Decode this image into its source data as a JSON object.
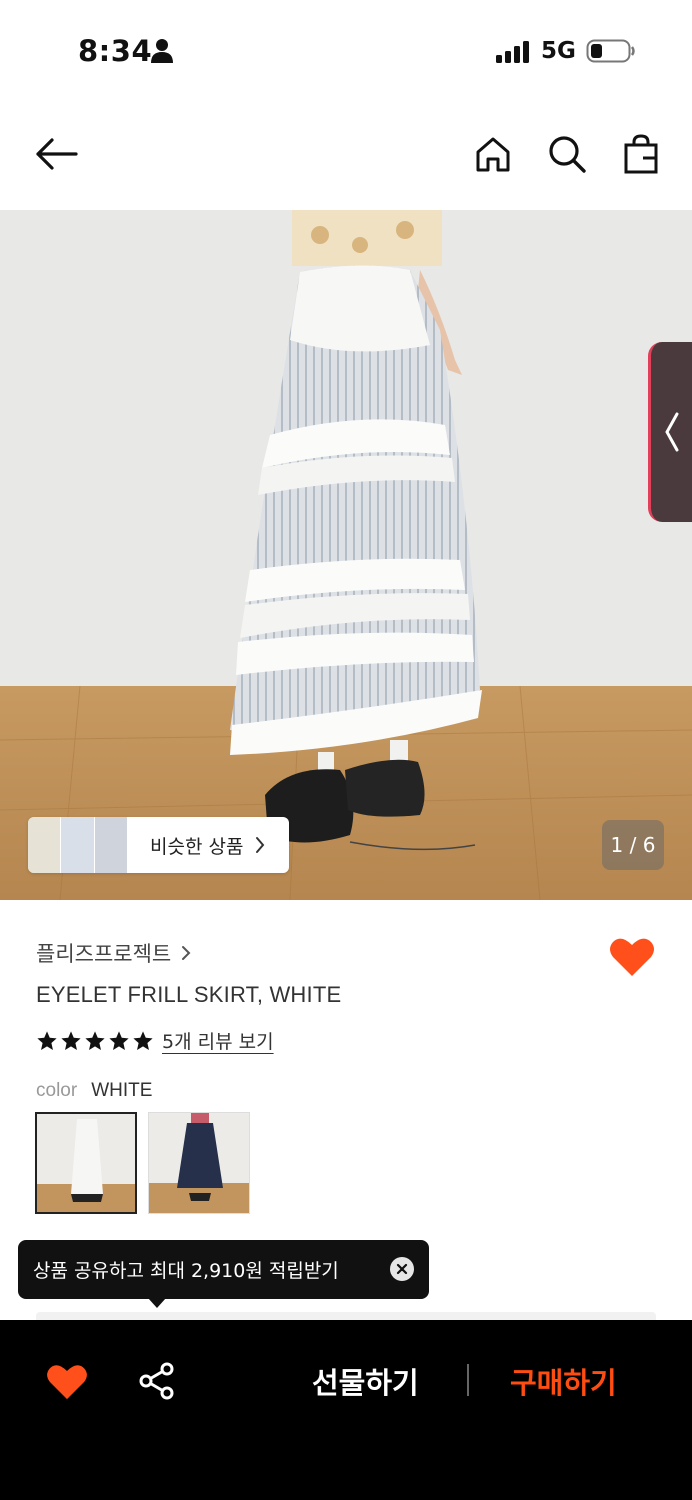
{
  "status_bar": {
    "time": "8:34",
    "network": "5G"
  },
  "nav": {
    "icons": [
      "back-arrow-icon",
      "home-icon",
      "search-icon",
      "shopping-bag-icon"
    ]
  },
  "gallery": {
    "similar_label": "비슷한 상품",
    "page_indicator": "1 / 6"
  },
  "product": {
    "brand": "플리즈프로젝트",
    "name": "EYELET FRILL SKIRT, WHITE",
    "rating_stars": 5,
    "review_link": "5개 리뷰 보기",
    "color_label": "color",
    "color_value": "WHITE",
    "wishlisted": true
  },
  "tooltip": {
    "text": "상품 공유하고 최대 2,910원 적립받기"
  },
  "bottom_bar": {
    "gift_label": "선물하기",
    "buy_label": "구매하기"
  },
  "colors": {
    "accent": "#ff4d12",
    "heart": "#ff4f1a"
  }
}
